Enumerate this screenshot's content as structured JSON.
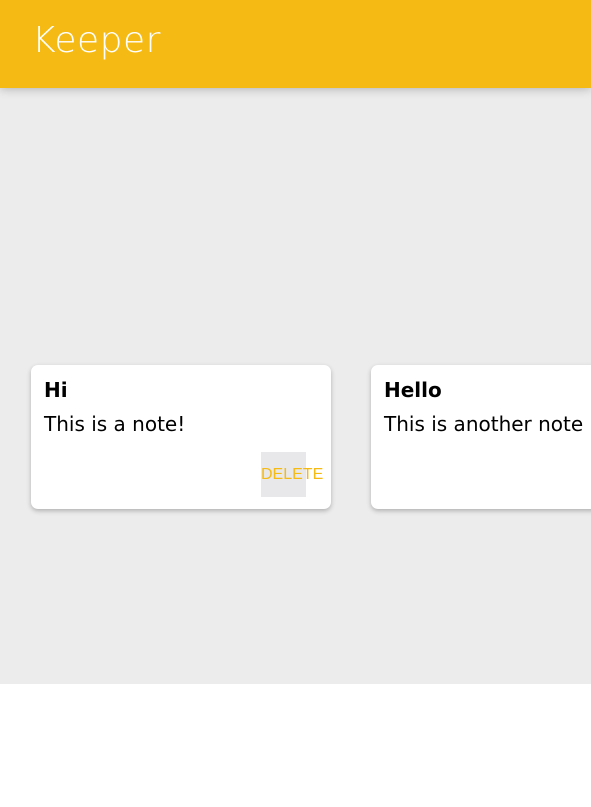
{
  "header": {
    "title": "Keeper"
  },
  "notes": [
    {
      "title": "Hi",
      "content": "This is a note!",
      "delete_label": "DELETE"
    },
    {
      "title": "Hello",
      "content": "This is another note"
    }
  ],
  "colors": {
    "header_background": "#f5ba13",
    "page_background": "#ececec",
    "note_background": "#ffffff",
    "delete_text": "#f5ba13",
    "delete_background": "#e8e8ea"
  }
}
